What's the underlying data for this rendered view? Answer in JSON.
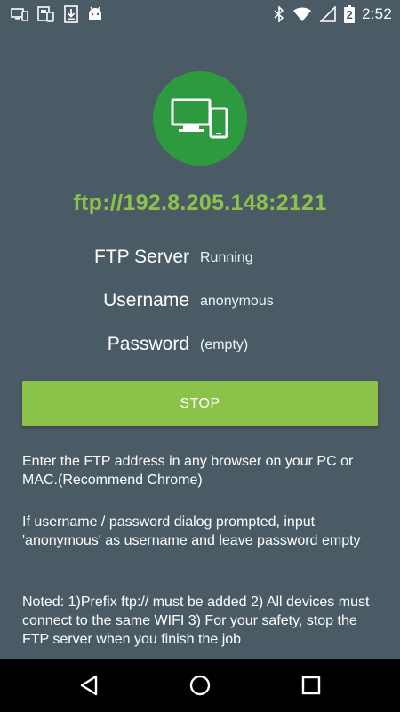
{
  "status_bar": {
    "time": "2:52",
    "battery_level": "2",
    "left_icons": [
      "screen-mirror-icon",
      "device-storage-icon",
      "download-icon",
      "android-icon"
    ],
    "right_icons": [
      "bluetooth-icon",
      "wifi-icon",
      "cell-signal-icon",
      "battery-icon"
    ]
  },
  "server": {
    "address": "ftp://192.8.205.148:2121",
    "rows": [
      {
        "label": "FTP Server",
        "value": "Running"
      },
      {
        "label": "Username",
        "value": "anonymous"
      },
      {
        "label": "Password",
        "value": "(empty)"
      }
    ],
    "stop_label": "STOP"
  },
  "help": {
    "instruction": "Enter the FTP address in any browser on your PC or MAC.(Recommend Chrome)",
    "login_hint": "If username / password dialog prompted, input 'anonymous' as username and leave password empty",
    "notes": "Noted: 1)Prefix ftp:// must be added 2) All devices must connect to the same WIFI 3) For your safety, stop the FTP server when you finish the job"
  },
  "colors": {
    "background": "#4a5b65",
    "accent": "#8bc34a",
    "logo_circle": "#2e9a3f",
    "nav_bar": "#000000"
  }
}
